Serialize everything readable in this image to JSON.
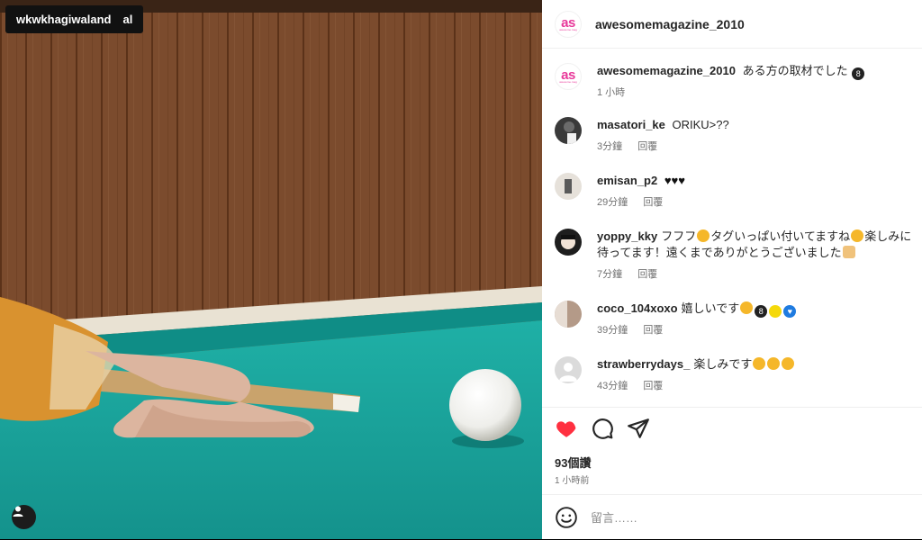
{
  "photo": {
    "tag_label": "wkwkhagiwaland　al"
  },
  "post": {
    "username": "awesomemagazine_2010",
    "logo_text": "as",
    "logo_subtext": "awesome.mag",
    "caption_user": "awesomemagazine_2010",
    "caption_text": "ある方の取材でした",
    "caption_time": "1 小時"
  },
  "comments": [
    {
      "user": "masatori_ke",
      "text": "ORIKU>??",
      "time": "3分鐘",
      "reply": "回覆",
      "avatar_color": "#3a3a3a"
    },
    {
      "user": "emisan_p2",
      "text": "",
      "time": "29分鐘",
      "reply": "回覆",
      "avatar_color": "#cfc8bf"
    },
    {
      "user": "yoppy_kky",
      "text": "フフフ",
      "text2": "タグいっぱい付いてますね",
      "text3": "楽しみに待ってます！遠くまでありがとうございました",
      "time": "7分鐘",
      "reply": "回覆",
      "avatar_color": "#1e1e1e"
    },
    {
      "user": "coco_104xoxo",
      "text": "嬉しいです",
      "time": "39分鐘",
      "reply": "回覆",
      "avatar_color": "#b49a88"
    },
    {
      "user": "strawberrydays_",
      "text": "楽しみです",
      "time": "43分鐘",
      "reply": "回覆",
      "avatar_color": "#dbdbdb"
    }
  ],
  "engagement": {
    "likes": "93個讚",
    "time": "1 小時前"
  },
  "compose": {
    "placeholder": "留言……"
  },
  "colors": {
    "accent_heart": "#ff3040",
    "brand_pink": "#e8399a",
    "felt": "#1aa7a0",
    "wall": "#7a4a2c"
  },
  "icons": [
    "heart-icon",
    "comment-icon",
    "share-icon",
    "emoji-icon",
    "user-tag-icon",
    "eight-ball-icon"
  ]
}
